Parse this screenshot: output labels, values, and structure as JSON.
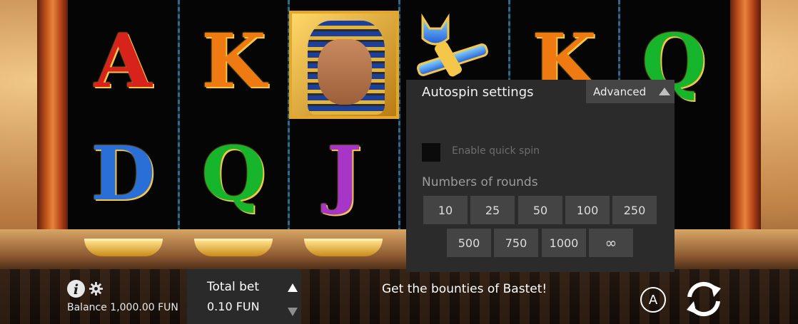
{
  "reels": {
    "row1": [
      "A",
      "K",
      "",
      "",
      "K",
      "Q"
    ],
    "row2": [
      "D",
      "Q",
      "J"
    ]
  },
  "colors": {
    "A": "#d8231c",
    "K": "#ef7a12",
    "Q": "#17b52b",
    "D": "#2a6ed8",
    "J": "#a735c8",
    "gold": "#f4c64a"
  },
  "autospin": {
    "title": "Autospin settings",
    "advanced_label": "Advanced",
    "quick_spin_label": "Enable quick spin",
    "rounds_label": "Numbers of rounds",
    "rounds": [
      "10",
      "25",
      "50",
      "100",
      "250",
      "500",
      "750",
      "1000",
      "∞"
    ]
  },
  "bottom_bar": {
    "balance": "Balance 1,000.00 FUN",
    "total_bet_label": "Total bet",
    "total_bet_value": "0.10 FUN",
    "message": "Get the bounties of Bastet!",
    "autoplay_letter": "A"
  },
  "icons": {
    "info": "info-icon",
    "settings": "gear-icon",
    "bet_up": "triangle-up-icon",
    "bet_down": "triangle-down-icon",
    "autoplay": "autoplay-icon",
    "spin": "spin-arrows-icon"
  }
}
